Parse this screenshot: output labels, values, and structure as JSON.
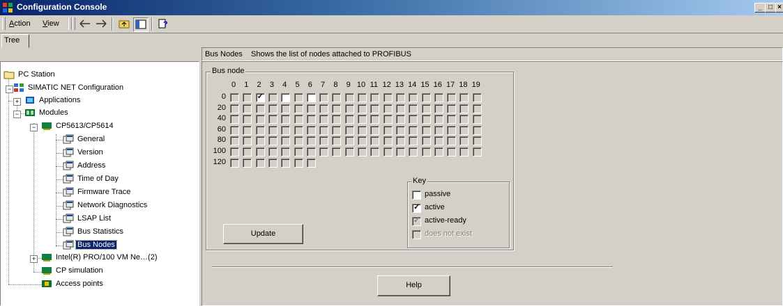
{
  "window": {
    "title": "Configuration Console",
    "min_label": "_",
    "max_label": "□",
    "close_label": "×"
  },
  "menu": {
    "action": "Action",
    "view": "View"
  },
  "toolbar": {
    "back_icon": "left-arrow-icon",
    "forward_icon": "right-arrow-icon",
    "up_icon": "folder-up-icon",
    "showhide_icon": "show-hide-tree-icon",
    "help_icon": "help-icon"
  },
  "tree_tab": "Tree",
  "tree": {
    "root": "PC Station",
    "simatic": "SIMATIC NET Configuration",
    "applications": "Applications",
    "modules": "Modules",
    "cp5613": "CP5613/CP5614",
    "children": [
      "General",
      "Version",
      "Address",
      "Time of Day",
      "Firmware Trace",
      "Network Diagnostics",
      "LSAP List",
      "Bus Statistics",
      "Bus Nodes"
    ],
    "intel": "Intel(R) PRO/100 VM Ne…(2)",
    "cp_sim": "CP simulation",
    "access": "Access points"
  },
  "header": {
    "name": "Bus Nodes",
    "description": "Shows the list of nodes attached to PROFIBUS"
  },
  "bus_node": {
    "title": "Bus node",
    "columns": [
      "0",
      "1",
      "2",
      "3",
      "4",
      "5",
      "6",
      "7",
      "8",
      "9",
      "10",
      "11",
      "12",
      "13",
      "14",
      "15",
      "16",
      "17",
      "18",
      "19"
    ],
    "rows": [
      "0",
      "20",
      "40",
      "60",
      "80",
      "100",
      "120"
    ],
    "active_nodes": [
      2
    ],
    "passive_nodes": [
      4,
      6
    ],
    "last_row_count": 7
  },
  "key": {
    "title": "Key",
    "passive": "passive",
    "active": "active",
    "active_ready": "active-ready",
    "not_exist": "does not exist"
  },
  "buttons": {
    "update": "Update",
    "help": "Help"
  },
  "colors": {
    "titlebar_start": "#0a246a",
    "titlebar_end": "#a6caf0",
    "face": "#d4d0c8",
    "selection": "#0a246a"
  }
}
